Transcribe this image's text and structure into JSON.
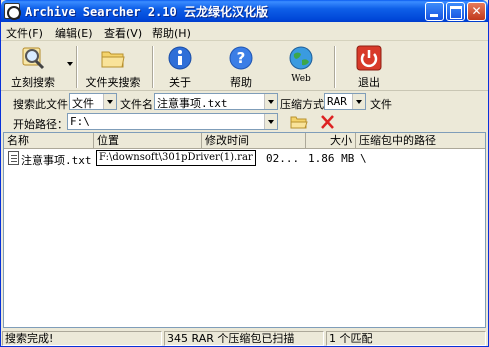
{
  "window": {
    "title": "Archive Searcher 2.10 云龙绿化汉化版"
  },
  "menu": [
    "文件(F)",
    "编辑(E)",
    "查看(V)",
    "帮助(H)"
  ],
  "toolbar": {
    "search_now": "立刻搜索",
    "folder_search": "文件夹搜索",
    "about": "关于",
    "help": "帮助",
    "web": "Web",
    "exit": "退出"
  },
  "search": {
    "search_in_label": "搜索此文件",
    "search_in_value": "文件",
    "filename_label": "文件名",
    "filename_value": "注意事项.txt",
    "compression_label": "压缩方式",
    "compression_value": "RAR",
    "file_suffix": "文件",
    "start_path_label": "开始路径：",
    "start_path_value": "F:\\"
  },
  "table": {
    "columns": [
      "名称",
      "位置",
      "修改时间",
      "大小",
      "压缩包中的路径"
    ],
    "rows": [
      {
        "name": "注意事项.txt",
        "location": "F:\\downsoft\\301pDriver(1).rar",
        "modified": "02...",
        "size": "1.86 MB",
        "archive_path": "\\"
      }
    ]
  },
  "status": {
    "left": "搜索完成!",
    "middle": "345 RAR 个压缩包已扫描",
    "right": "1 个匹配"
  },
  "colors": {
    "title_bar": "#0a5bf0",
    "close_button": "#c0381b",
    "window_bg": "#ece9d8"
  }
}
